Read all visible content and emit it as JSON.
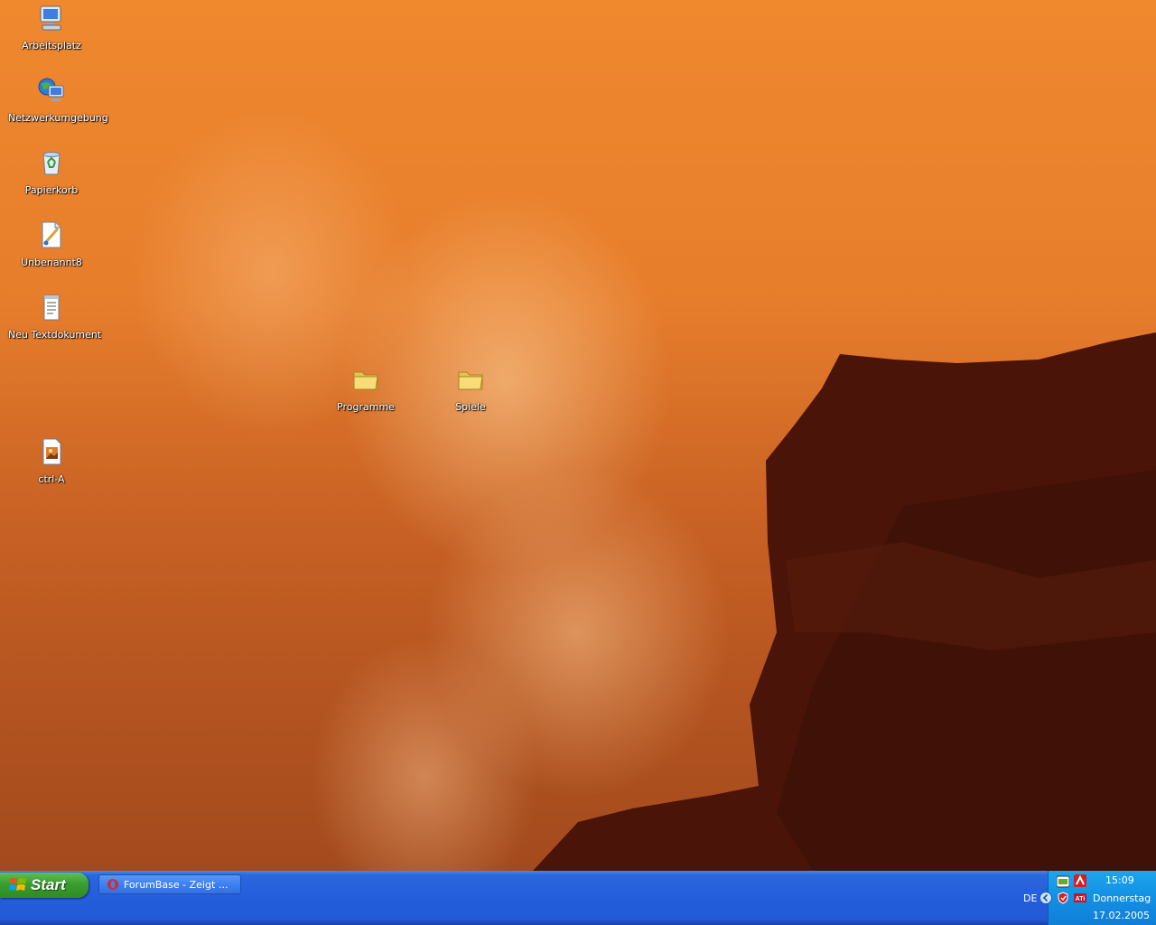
{
  "desktop": {
    "icons": [
      {
        "label": "Arbeitsplatz",
        "icon": "my-computer-icon"
      },
      {
        "label": "Netzwerkumgebung",
        "icon": "network-places-icon"
      },
      {
        "label": "Papierkorb",
        "icon": "recycle-bin-icon"
      },
      {
        "label": "Unbenannt8",
        "icon": "paint-file-icon"
      },
      {
        "label": "Neu Textdokument",
        "icon": "text-document-icon"
      },
      {
        "label": "Programme",
        "icon": "folder-icon"
      },
      {
        "label": "Spiele",
        "icon": "folder-icon"
      },
      {
        "label": "ctrl-A",
        "icon": "image-file-icon"
      }
    ]
  },
  "taskbar": {
    "start_label": "Start",
    "tasks": [
      {
        "label": "ForumBase - Zeigt mir...",
        "icon": "opera-icon"
      }
    ],
    "tray": {
      "language": "DE",
      "time": "15:09",
      "day": "Donnerstag",
      "date": "17.02.2005",
      "icons": [
        "nvidia-icon",
        "antivir-icon",
        "show-hidden-icon",
        "shield-icon",
        "ati-icon"
      ]
    }
  },
  "colors": {
    "taskbar_blue": "#245edb",
    "start_green": "#3a9d2f",
    "tray_blue": "#1290e4",
    "sky_orange": "#f0882e",
    "rock_dark": "#4a1408"
  }
}
